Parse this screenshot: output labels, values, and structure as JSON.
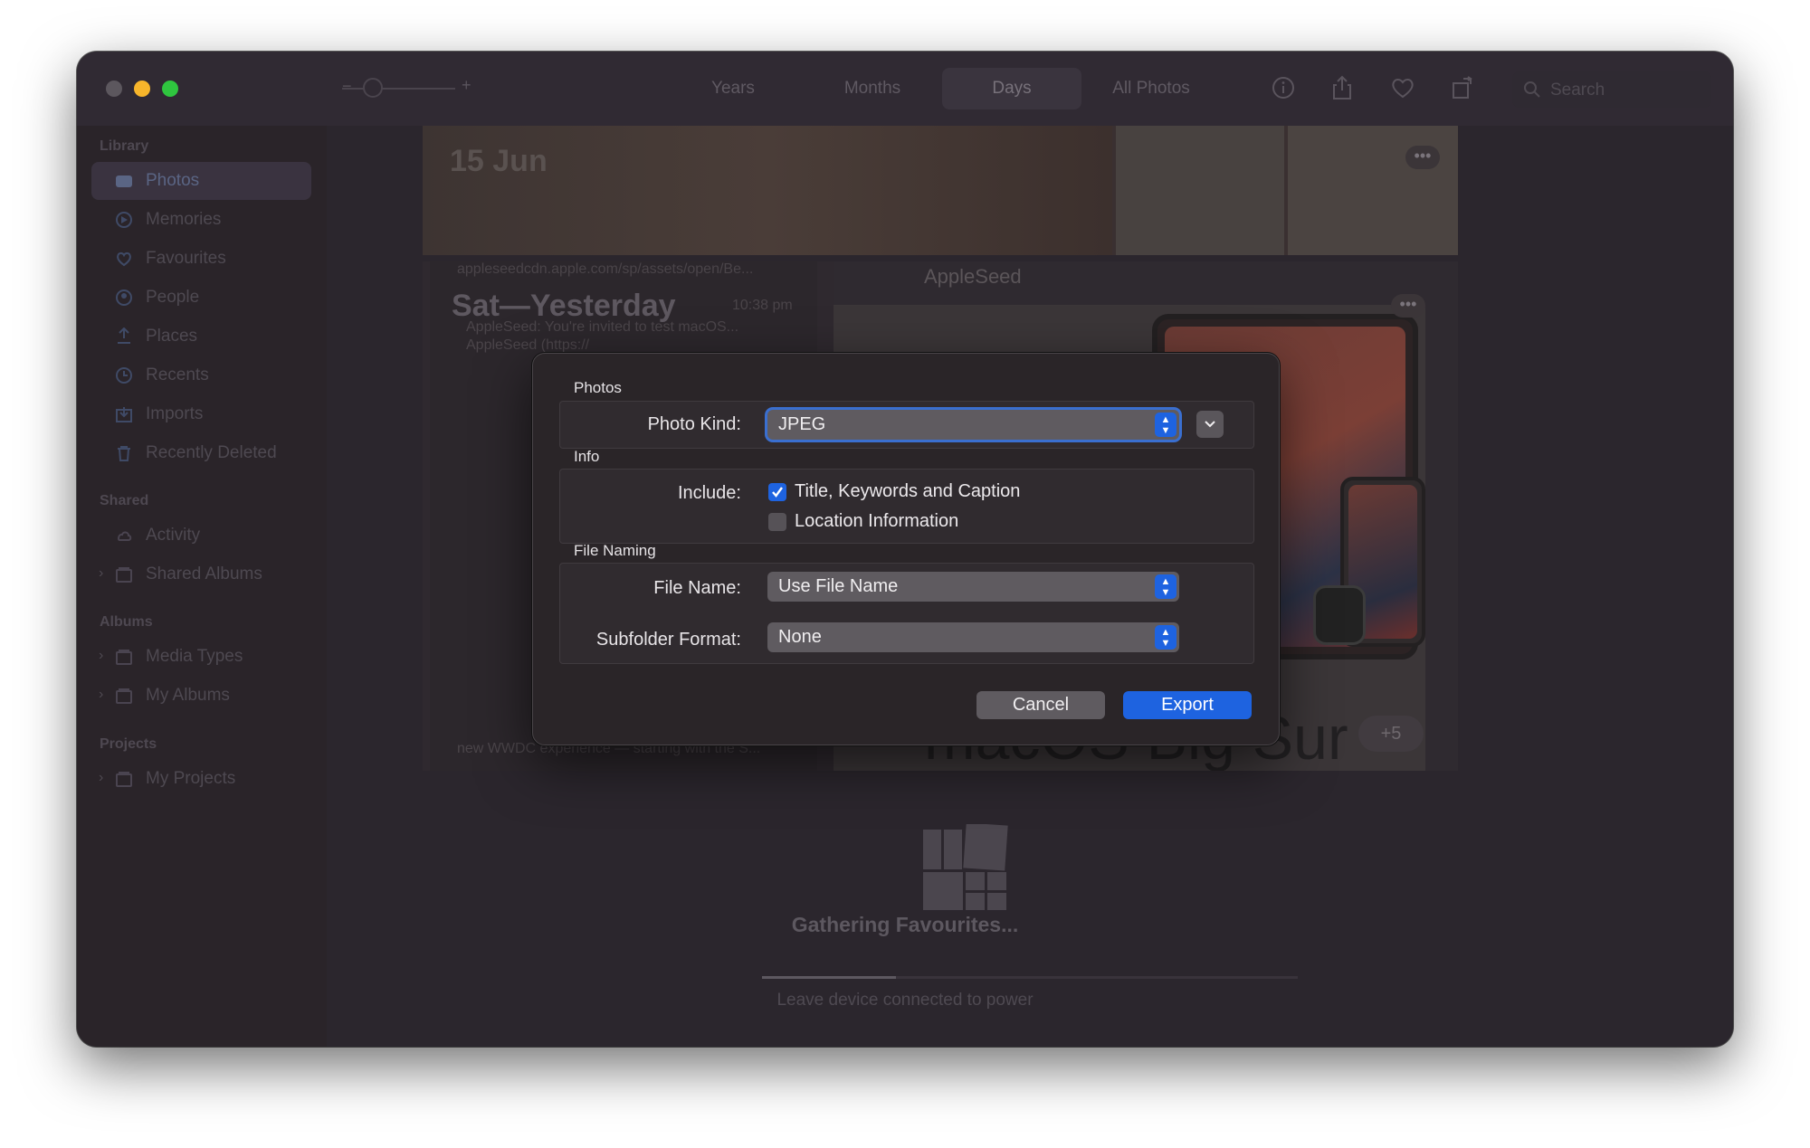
{
  "toolbar": {
    "tabs": [
      {
        "label": "Years",
        "active": false
      },
      {
        "label": "Months",
        "active": false
      },
      {
        "label": "Days",
        "active": true
      },
      {
        "label": "All Photos",
        "active": false
      }
    ],
    "zoom_minus": "−",
    "zoom_plus": "+",
    "search_placeholder": "Search",
    "icons": [
      "info-icon",
      "share-icon",
      "heart-icon",
      "rotate-icon",
      "search-icon"
    ]
  },
  "sidebar": {
    "library_heading": "Library",
    "library_items": [
      {
        "label": "Photos",
        "icon": "photos-icon",
        "selected": true
      },
      {
        "label": "Memories",
        "icon": "memories-icon"
      },
      {
        "label": "Favourites",
        "icon": "heart-icon"
      },
      {
        "label": "People",
        "icon": "people-icon"
      },
      {
        "label": "Places",
        "icon": "places-icon"
      },
      {
        "label": "Recents",
        "icon": "clock-icon"
      },
      {
        "label": "Imports",
        "icon": "imports-icon"
      },
      {
        "label": "Recently Deleted",
        "icon": "trash-icon"
      }
    ],
    "shared_heading": "Shared",
    "shared_items": [
      {
        "label": "Activity",
        "icon": "cloud-icon"
      },
      {
        "label": "Shared Albums",
        "icon": "folder-icon",
        "expandable": true
      }
    ],
    "albums_heading": "Albums",
    "albums_items": [
      {
        "label": "Media Types",
        "icon": "folder-icon",
        "expandable": true
      },
      {
        "label": "My Albums",
        "icon": "folder-icon",
        "expandable": true
      }
    ],
    "projects_heading": "Projects",
    "projects_items": [
      {
        "label": "My Projects",
        "icon": "folder-icon",
        "expandable": true
      }
    ]
  },
  "main": {
    "top_date": "15 Jun",
    "card": {
      "url": "appleseedcdn.apple.com/sp/assets/open/Be...",
      "title": "Sat—Yesterday",
      "time": "10:38 pm",
      "line1": "AppleSeed: You're invited to test macOS...",
      "line2": "AppleSeed (https://",
      "footer": "new WWDC experience — starting with the S...",
      "brand": "AppleSeed",
      "hero_text": "macOS Big Sur",
      "more_count": "+5"
    },
    "gathering_title": "Gathering Favourites...",
    "gathering_sub": "Leave device connected to power",
    "progress": 0.25
  },
  "dialog": {
    "photos_section": "Photos",
    "photo_kind_label": "Photo Kind:",
    "photo_kind_value": "JPEG",
    "info_section": "Info",
    "include_label": "Include:",
    "include_options": [
      {
        "label": "Title, Keywords and Caption",
        "checked": true
      },
      {
        "label": "Location Information",
        "checked": false
      }
    ],
    "file_naming_section": "File Naming",
    "file_name_label": "File Name:",
    "file_name_value": "Use File Name",
    "subfolder_label": "Subfolder Format:",
    "subfolder_value": "None",
    "cancel_label": "Cancel",
    "export_label": "Export"
  },
  "colors": {
    "accent": "#1e63e0",
    "dialog_bg": "#2a2528",
    "window_bg": "#2b262d"
  }
}
